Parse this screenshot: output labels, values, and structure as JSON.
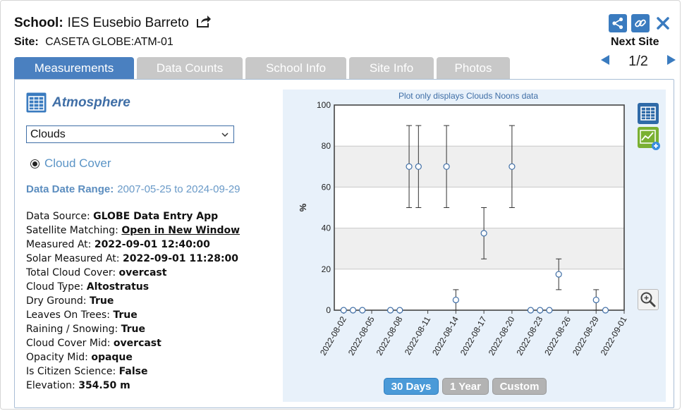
{
  "header": {
    "school_label": "School:",
    "school_name": "IES Eusebio Barreto",
    "site_label": "Site:",
    "site_name": "CASETA GLOBE:ATM-01",
    "next_site_label": "Next Site",
    "pager_text": "1/2"
  },
  "tabs": [
    {
      "label": "Measurements",
      "active": true
    },
    {
      "label": "Data Counts",
      "active": false
    },
    {
      "label": "School Info",
      "active": false
    },
    {
      "label": "Site Info",
      "active": false
    },
    {
      "label": "Photos",
      "active": false
    }
  ],
  "panel": {
    "title": "Atmosphere",
    "select_value": "Clouds",
    "radio_label": "Cloud Cover",
    "date_range_label": "Data Date Range:",
    "date_range_value": "2007-05-25 to 2024-09-29"
  },
  "details": [
    {
      "label": "Data Source:",
      "value": "GLOBE Data Entry App"
    },
    {
      "label": "Satellite Matching:",
      "value": "Open in New Window"
    },
    {
      "label": "Measured At:",
      "value": "2022-09-01 12:40:00"
    },
    {
      "label": "Solar Measured At:",
      "value": "2022-09-01 11:28:00"
    },
    {
      "label": "Total Cloud Cover:",
      "value": "overcast"
    },
    {
      "label": "Cloud Type:",
      "value": "Altostratus"
    },
    {
      "label": "Dry Ground:",
      "value": "True"
    },
    {
      "label": "Leaves On Trees:",
      "value": "True"
    },
    {
      "label": "Raining / Snowing:",
      "value": "True"
    },
    {
      "label": "Cloud Cover Mid:",
      "value": "overcast"
    },
    {
      "label": "Opacity Mid:",
      "value": "opaque"
    },
    {
      "label": "Is Citizen Science:",
      "value": "False"
    },
    {
      "label": "Elevation:",
      "value": "354.50 m"
    }
  ],
  "chart_note": "Plot only displays Clouds Noons data",
  "range_buttons": [
    {
      "label": "30 Days",
      "active": true
    },
    {
      "label": "1 Year",
      "active": false
    },
    {
      "label": "Custom",
      "active": false
    }
  ],
  "colors": {
    "accent": "#4a80c0",
    "tab_inactive": "#c8c8c8",
    "chart_bg": "#e8f1fa",
    "marker_stroke": "#3f6ea6"
  },
  "icons": {
    "share": "share-icon",
    "link": "link-icon",
    "close": "close-icon",
    "external": "external-link-icon",
    "table": "table-icon",
    "add_chart": "add-chart-icon",
    "zoom": "zoom-in-icon"
  },
  "chart_data": {
    "type": "scatter",
    "title": "",
    "xlabel": "",
    "ylabel": "%",
    "xlim": [
      "2022-08-01",
      "2022-09-01"
    ],
    "ylim": [
      0,
      100
    ],
    "yticks": [
      0,
      20,
      40,
      60,
      80,
      100
    ],
    "xticks": [
      "2022-08-02",
      "2022-08-05",
      "2022-08-08",
      "2022-08-11",
      "2022-08-14",
      "2022-08-17",
      "2022-08-20",
      "2022-08-23",
      "2022-08-26",
      "2022-08-29",
      "2022-09-01"
    ],
    "grid": true,
    "points": [
      {
        "x": "2022-08-02",
        "y": 0
      },
      {
        "x": "2022-08-03",
        "y": 0
      },
      {
        "x": "2022-08-04",
        "y": 0
      },
      {
        "x": "2022-08-07",
        "y": 0
      },
      {
        "x": "2022-08-08",
        "y": 0
      },
      {
        "x": "2022-08-09",
        "y": 70,
        "low": 50,
        "high": 90
      },
      {
        "x": "2022-08-10",
        "y": 70,
        "low": 50,
        "high": 90
      },
      {
        "x": "2022-08-13",
        "y": 70,
        "low": 50,
        "high": 90
      },
      {
        "x": "2022-08-14",
        "y": 5,
        "low": 0,
        "high": 10
      },
      {
        "x": "2022-08-17",
        "y": 37.5,
        "low": 25,
        "high": 50
      },
      {
        "x": "2022-08-20",
        "y": 70,
        "low": 50,
        "high": 90
      },
      {
        "x": "2022-08-22",
        "y": 0
      },
      {
        "x": "2022-08-23",
        "y": 0
      },
      {
        "x": "2022-08-24",
        "y": 0
      },
      {
        "x": "2022-08-25",
        "y": 17.5,
        "low": 10,
        "high": 25
      },
      {
        "x": "2022-08-29",
        "y": 5,
        "low": 0,
        "high": 10
      },
      {
        "x": "2022-08-30",
        "y": 0
      }
    ]
  }
}
